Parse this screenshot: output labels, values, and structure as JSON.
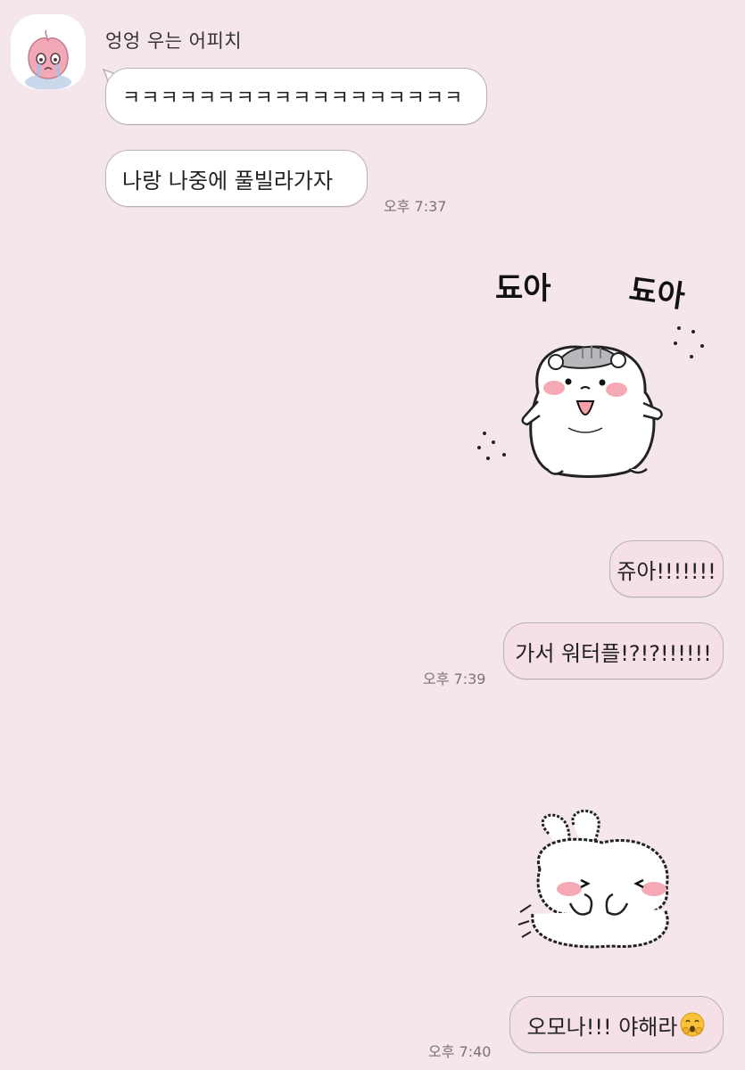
{
  "chat": {
    "sender": {
      "name": "엉엉 우는 어피치",
      "avatar_icon": "crying-peach-avatar"
    },
    "messages": [
      {
        "id": "m1",
        "direction": "incoming",
        "text": "ㅋㅋㅋㅋㅋㅋㅋㅋㅋㅋㅋㅋㅋㅋㅋㅋㅋㅋ"
      },
      {
        "id": "m2",
        "direction": "incoming",
        "text": "나랑 나중에 풀빌라가자",
        "time": "오후 7:37"
      },
      {
        "id": "s1",
        "direction": "outgoing",
        "type": "sticker",
        "sticker_icon": "hamster-doa-sticker",
        "sticker_text_left": "됴아",
        "sticker_text_right": "됴아"
      },
      {
        "id": "m3",
        "direction": "outgoing",
        "text": "쥬아!!!!!!!"
      },
      {
        "id": "m4",
        "direction": "outgoing",
        "text": "가서 워터플!?!?!!!!!!",
        "time": "오후 7:39"
      },
      {
        "id": "s2",
        "direction": "outgoing",
        "type": "sticker",
        "sticker_icon": "shy-bunny-sticker"
      },
      {
        "id": "m5",
        "direction": "outgoing",
        "text": "오모나!!! 야해라",
        "emoji": "shy-face-emoji",
        "time": "오후 7:40"
      }
    ]
  },
  "colors": {
    "background": "#f4e6eb",
    "incoming_bubble": "#ffffff",
    "outgoing_bubble": "#f5e0e7",
    "bubble_border": "#b9b2b6",
    "time_text": "#7b7378",
    "blush": "#f4a9b4"
  }
}
